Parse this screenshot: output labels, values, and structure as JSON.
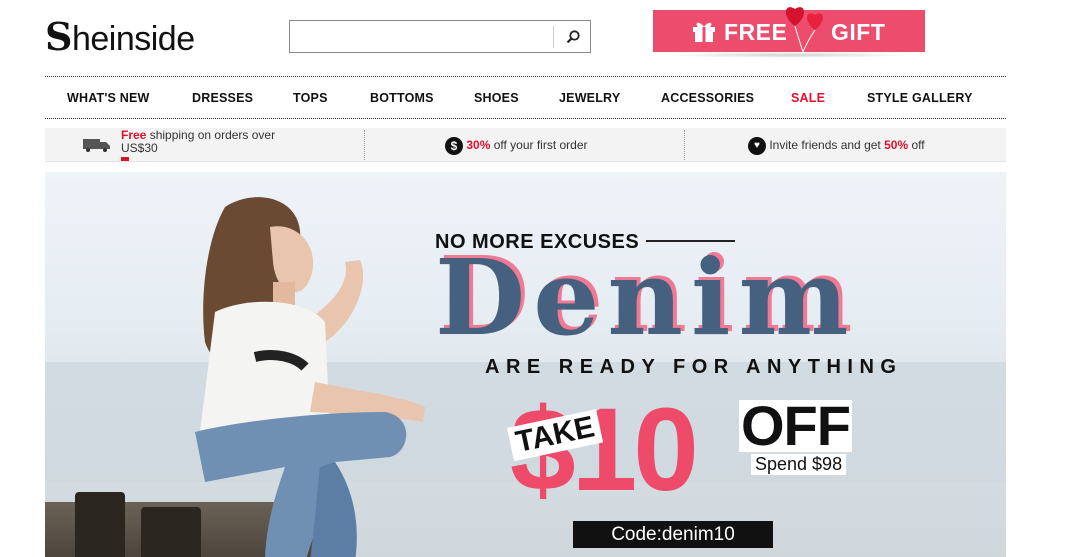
{
  "header": {
    "logo_text": "heinside",
    "logo_initial": "S",
    "search": {
      "placeholder": "",
      "value": "",
      "button_icon": "search-icon"
    },
    "gift_banner": {
      "word1": "FREE",
      "word2": "GIFT",
      "bg_color": "#ec4d6d",
      "icons": [
        "gift-box-icon",
        "heart-balloons-icon"
      ]
    }
  },
  "nav": {
    "items": [
      {
        "label": "WHAT'S NEW"
      },
      {
        "label": "DRESSES"
      },
      {
        "label": "TOPS"
      },
      {
        "label": "BOTTOMS"
      },
      {
        "label": "SHOES"
      },
      {
        "label": "JEWELRY"
      },
      {
        "label": "ACCESSORIES"
      },
      {
        "label": "SALE",
        "color": "#e0112b"
      },
      {
        "label": "STYLE GALLERY"
      }
    ]
  },
  "promo_strip": {
    "shipping": {
      "highlight": "Free",
      "text": " shipping on orders over",
      "amount": "US$30",
      "icon": "truck-icon"
    },
    "first_order": {
      "highlight": "30%",
      "text": " off your first order",
      "icon": "dollar-circle-icon"
    },
    "invite": {
      "text": "Invite friends and get ",
      "highlight": "50%",
      "suffix": " off",
      "icon": "heart-circle-icon"
    }
  },
  "banner": {
    "kicker": "NO MORE EXCUSES",
    "title": "Denim",
    "subtitle": "ARE READY FOR ANYTHING",
    "take": "TAKE",
    "amount": "$10",
    "off": "OFF",
    "spend": "Spend $98",
    "code": "Code:denim10",
    "accent_color": "#ee4b6a",
    "denim_color": "#46607f"
  }
}
